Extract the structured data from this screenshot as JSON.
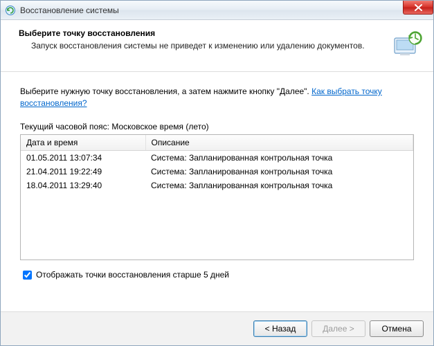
{
  "window": {
    "title": "Восстановление системы"
  },
  "header": {
    "title": "Выберите точку восстановления",
    "subtitle": "Запуск восстановления системы не приведет к изменению или удалению документов."
  },
  "content": {
    "instruction_prefix": "Выберите нужную точку восстановления, а затем нажмите кнопку \"Далее\". ",
    "help_link": "Как выбрать точку восстановления?",
    "tz_label": "Текущий часовой пояс: Московское время (лето)"
  },
  "table": {
    "headers": {
      "date": "Дата и время",
      "desc": "Описание"
    },
    "rows": [
      {
        "date": "01.05.2011 13:07:34",
        "desc": "Система: Запланированная контрольная точка"
      },
      {
        "date": "21.04.2011 19:22:49",
        "desc": "Система: Запланированная контрольная точка"
      },
      {
        "date": "18.04.2011 13:29:40",
        "desc": "Система: Запланированная контрольная точка"
      }
    ]
  },
  "checkbox": {
    "label": "Отображать точки восстановления старше 5 дней",
    "checked": true
  },
  "buttons": {
    "back": "< Назад",
    "next": "Далее >",
    "cancel": "Отмена"
  }
}
